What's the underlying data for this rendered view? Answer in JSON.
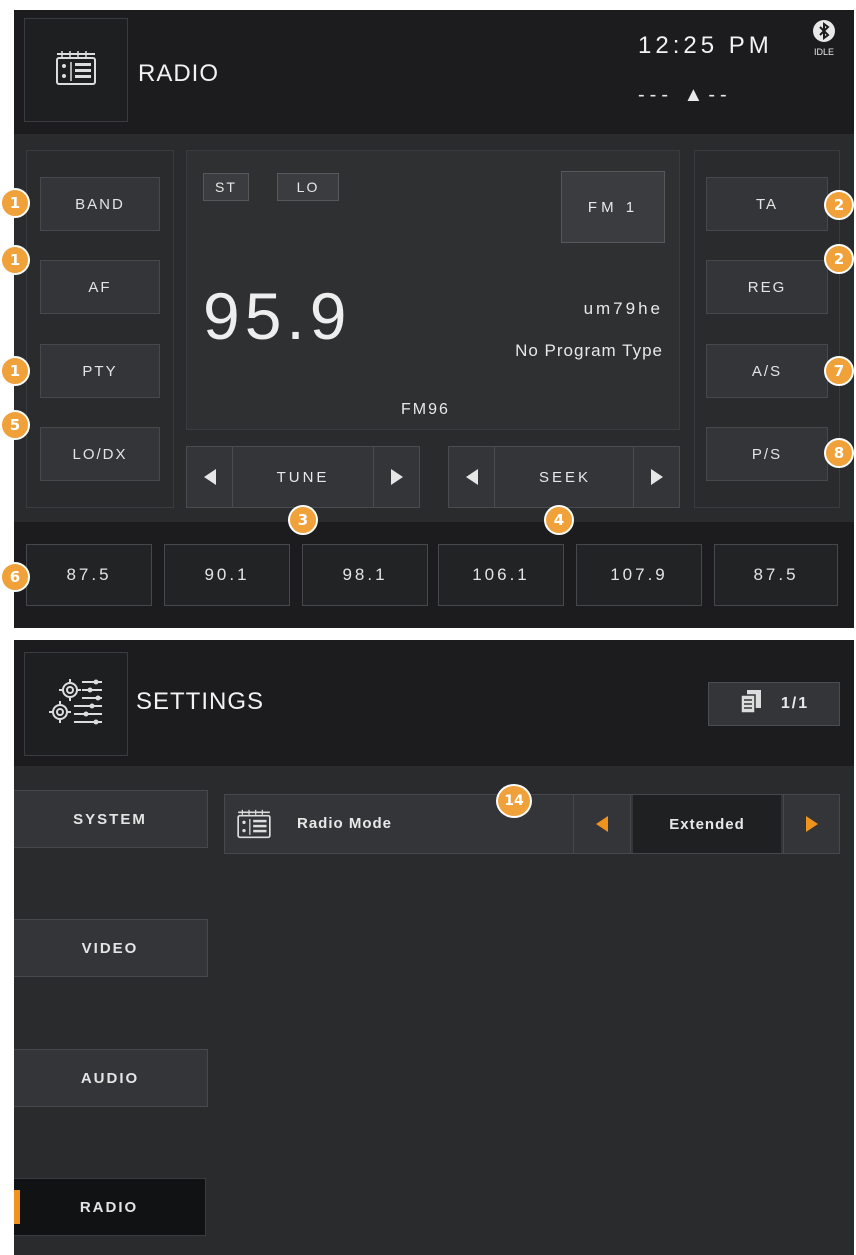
{
  "radio": {
    "title": "RADIO",
    "clock": "12:25 PM",
    "bluetooth_status": "IDLE",
    "compass": "--- ▲--",
    "left_buttons": [
      "BAND",
      "AF",
      "PTY",
      "LO/DX"
    ],
    "right_buttons": [
      "TA",
      "REG",
      "A/S",
      "P/S"
    ],
    "display": {
      "st": "ST",
      "lo": "LO",
      "band": "FM 1",
      "frequency": "95.9",
      "rds_text": "um79he",
      "program_type": "No Program Type",
      "station": "FM96"
    },
    "tune_label": "TUNE",
    "seek_label": "SEEK",
    "presets": [
      "87.5",
      "90.1",
      "98.1",
      "106.1",
      "107.9",
      "87.5"
    ]
  },
  "settings": {
    "title": "SETTINGS",
    "page_indicator": "1/1",
    "nav": [
      "SYSTEM",
      "VIDEO",
      "AUDIO",
      "RADIO"
    ],
    "active_nav": "RADIO",
    "option_label": "Radio Mode",
    "option_value": "Extended"
  },
  "callouts": {
    "band": "1",
    "af": "1",
    "pty": "1",
    "lodx": "5",
    "ta": "2",
    "reg": "2",
    "as": "7",
    "ps": "8",
    "tune": "3",
    "seek": "4",
    "presets": "6",
    "radio_mode": "14"
  },
  "colors": {
    "accent_orange": "#f0a13a",
    "panel_bg": "#2a2b2d",
    "header_bg": "#1c1c1e"
  }
}
